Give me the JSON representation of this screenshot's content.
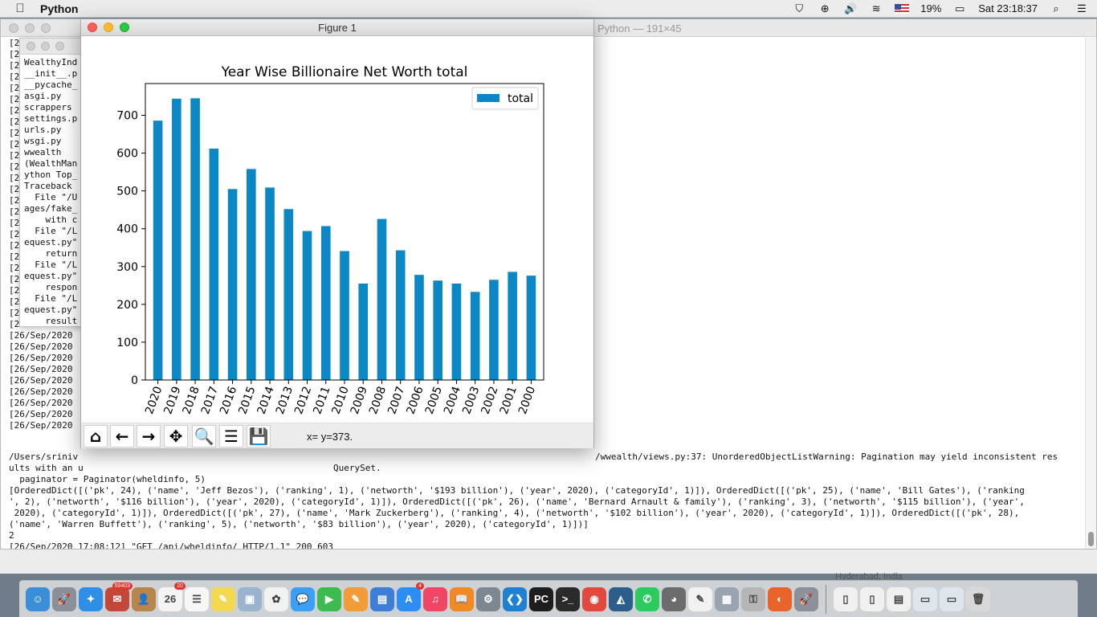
{
  "menubar": {
    "apple_icon": "apple-logo-icon",
    "app_name": "Python",
    "battery": "19%",
    "clock": "Sat 23:18:37",
    "status_icons": [
      "vpn-shield-icon",
      "accessibility-icon",
      "volume-icon",
      "wifi-icon",
      "us-flag-icon",
      "battery-icon",
      "spotlight-search-icon",
      "notification-center-icon"
    ]
  },
  "terminal": {
    "title": "Python — 191×45",
    "left_column": [
      "[20",
      "[20",
      "[20",
      "[20",
      "[20",
      "[20",
      "[20",
      "[20",
      "[20",
      "[20",
      "[20",
      "[20",
      "[20",
      "[20",
      "[20",
      "[20",
      "[20",
      "[20",
      "[20",
      "[20",
      "[20",
      "[20",
      "[20",
      "[20",
      "[20",
      "[20",
      "[26/Sep/2020",
      "[26/Sep/2020",
      "[26/Sep/2020",
      "[26/Sep/2020",
      "[26/Sep/2020",
      "[26/Sep/2020",
      "[26/Sep/2020",
      "[26/Sep/2020",
      "[26/Sep/2020"
    ],
    "right_fragment": "/wwealth/views.py:37: UnorderedObjectListWarning: Pagination may yield inconsistent res",
    "bottom_lines": [
      "/Users/sriniv",
      "ults with an u                                               QuerySet.",
      "  paginator = Paginator(wheldinfo, 5)",
      "[OrderedDict([('pk', 24), ('name', 'Jeff Bezos'), ('ranking', 1), ('networth', '$193 billion'), ('year', 2020), ('categoryId', 1)]), OrderedDict([('pk', 25), ('name', 'Bill Gates'), ('ranking",
      "', 2), ('networth', '$116 billion'), ('year', 2020), ('categoryId', 1)]), OrderedDict([('pk', 26), ('name', 'Bernard Arnault & family'), ('ranking', 3), ('networth', '$115 billion'), ('year',",
      " 2020), ('categoryId', 1)]), OrderedDict([('pk', 27), ('name', 'Mark Zuckerberg'), ('ranking', 4), ('networth', '$102 billion'), ('year', 2020), ('categoryId', 1)]), OrderedDict([('pk', 28),",
      "('name', 'Warren Buffett'), ('ranking', 5), ('networth', '$83 billion'), ('year', 2020), ('categoryId', 1)])]",
      "2",
      "[26/Sep/2020 17:08:12] \"GET /api/wheldinfo/ HTTP/1.1\" 200 603"
    ]
  },
  "inner_terminal": {
    "lines": [
      "WealthyInd",
      "__init__.p",
      "__pycache_",
      "asgi.py",
      "scrappers",
      "settings.p",
      "urls.py",
      "wsgi.py",
      "wwealth",
      "(WealthMan",
      "ython Top_",
      "Traceback ",
      "  File \"/U",
      "ages/fake_",
      "    with c",
      "  File \"/L",
      "equest.py\"",
      "    return",
      "  File \"/L",
      "equest.py\"",
      "    respon",
      "  File \"/L",
      "equest.py\"",
      "    result"
    ]
  },
  "figure": {
    "window_title": "Figure 1",
    "coord_readout": "x= y=373.",
    "toolbar": [
      {
        "name": "home-button",
        "icon": "home-icon",
        "glyph": "⌂"
      },
      {
        "name": "back-button",
        "icon": "arrow-left-icon",
        "glyph": "←"
      },
      {
        "name": "forward-button",
        "icon": "arrow-right-icon",
        "glyph": "→"
      },
      {
        "name": "pan-button",
        "icon": "move-arrows-icon",
        "glyph": "✥"
      },
      {
        "name": "zoom-button",
        "icon": "magnifier-icon",
        "glyph": "🔍"
      },
      {
        "name": "subplots-button",
        "icon": "sliders-icon",
        "glyph": "☰"
      },
      {
        "name": "save-button",
        "icon": "floppy-disk-icon",
        "glyph": "💾"
      }
    ]
  },
  "chart_data": {
    "type": "bar",
    "title": "Year Wise Billionaire Net Worth total",
    "xlabel": "",
    "ylabel": "",
    "categories": [
      "2020",
      "2019",
      "2018",
      "2017",
      "2016",
      "2015",
      "2014",
      "2013",
      "2012",
      "2011",
      "2010",
      "2009",
      "2008",
      "2007",
      "2006",
      "2005",
      "2004",
      "2003",
      "2002",
      "2001",
      "2000"
    ],
    "series": [
      {
        "name": "total",
        "color": "#0a87c4",
        "values": [
          686,
          744,
          745,
          612,
          505,
          558,
          509,
          452,
          394,
          407,
          341,
          255,
          426,
          343,
          278,
          263,
          255,
          233,
          265,
          286,
          276
        ]
      }
    ],
    "ylim": [
      0,
      784
    ],
    "yticks": [
      0,
      100,
      200,
      300,
      400,
      500,
      600,
      700
    ],
    "xtick_rotation": "-70deg",
    "legend": "top-right",
    "grid": false
  },
  "dock": {
    "apps": [
      {
        "name": "finder",
        "icon": "finder-icon",
        "color": "#3b8fd9",
        "glyph": "☺"
      },
      {
        "name": "launchpad",
        "icon": "rocket-icon",
        "color": "#8a8f9a",
        "glyph": "🚀"
      },
      {
        "name": "safari",
        "icon": "compass-icon",
        "color": "#2f8ee5",
        "glyph": "✦"
      },
      {
        "name": "mail",
        "icon": "mail-icon",
        "color": "#c4473a",
        "glyph": "✉",
        "badge": "59403"
      },
      {
        "name": "contacts",
        "icon": "contacts-icon",
        "color": "#b8864a",
        "glyph": "👤"
      },
      {
        "name": "calendar",
        "icon": "calendar-icon",
        "color": "#f4f4f4",
        "glyph": "26",
        "badge": "20"
      },
      {
        "name": "reminders",
        "icon": "list-icon",
        "color": "#f7f7f7",
        "glyph": "☰"
      },
      {
        "name": "notes",
        "icon": "notes-icon",
        "color": "#f3d94f",
        "glyph": "✎"
      },
      {
        "name": "preview",
        "icon": "photos-viewer-icon",
        "color": "#9ab4cf",
        "glyph": "▣"
      },
      {
        "name": "photos",
        "icon": "photos-flower-icon",
        "color": "#f2f2f2",
        "glyph": "✿"
      },
      {
        "name": "messages",
        "icon": "chat-bubble-icon",
        "color": "#3aa0f5",
        "glyph": "💬"
      },
      {
        "name": "facetime",
        "icon": "camera-icon",
        "color": "#3dbb4f",
        "glyph": "▶"
      },
      {
        "name": "pages",
        "icon": "document-pen-icon",
        "color": "#f19b39",
        "glyph": "✎"
      },
      {
        "name": "keynote",
        "icon": "presentation-icon",
        "color": "#3d7fd6",
        "glyph": "▤"
      },
      {
        "name": "app-store",
        "icon": "app-store-icon",
        "color": "#2c8ef3",
        "glyph": "A",
        "badge": "4"
      },
      {
        "name": "music",
        "icon": "music-note-icon",
        "color": "#f04565",
        "glyph": "♫"
      },
      {
        "name": "books",
        "icon": "book-icon",
        "color": "#f08a24",
        "glyph": "📖"
      },
      {
        "name": "system-preferences",
        "icon": "gear-icon",
        "color": "#7d8791",
        "glyph": "⚙"
      },
      {
        "name": "vscode",
        "icon": "code-icon",
        "color": "#1f7fd0",
        "glyph": "❮❯"
      },
      {
        "name": "pycharm",
        "icon": "pycharm-icon",
        "color": "#1d1d1d",
        "glyph": "PC"
      },
      {
        "name": "terminal",
        "icon": "terminal-icon",
        "color": "#2a2a2a",
        "glyph": ">_"
      },
      {
        "name": "chrome",
        "icon": "chrome-icon",
        "color": "#e2483b",
        "glyph": "◉"
      },
      {
        "name": "mysql-workbench",
        "icon": "dolphin-icon",
        "color": "#2d5d8a",
        "glyph": "◭"
      },
      {
        "name": "whatsapp",
        "icon": "whatsapp-icon",
        "color": "#2bcc5d",
        "glyph": "✆"
      },
      {
        "name": "sequel-pro",
        "icon": "elephant-icon",
        "color": "#6c6c6c",
        "glyph": "◕"
      },
      {
        "name": "textedit",
        "icon": "pencil-paper-icon",
        "color": "#f2f2f2",
        "glyph": "✎"
      },
      {
        "name": "screenshot",
        "icon": "screenshot-icon",
        "color": "#9aa4b0",
        "glyph": "▦"
      },
      {
        "name": "keychain",
        "icon": "keys-icon",
        "color": "#b6b6b6",
        "glyph": "⚿"
      },
      {
        "name": "firefox",
        "icon": "firefox-icon",
        "color": "#e8642a",
        "glyph": "◐"
      },
      {
        "name": "python-launcher",
        "icon": "rocket-python-icon",
        "color": "#8c9098",
        "glyph": "🚀"
      }
    ],
    "stack_items": [
      {
        "name": "downloads-stack",
        "icon": "zip-file-icon",
        "color": "#f0f0f0",
        "glyph": "▯"
      },
      {
        "name": "pdf-stack",
        "icon": "pdf-file-icon",
        "color": "#f0f0f0",
        "glyph": "▯"
      },
      {
        "name": "documents-stack",
        "icon": "documents-icon",
        "color": "#f0f0f0",
        "glyph": "▤"
      },
      {
        "name": "desktop-stack",
        "icon": "desktop-screenshots-icon",
        "color": "#dfe5ec",
        "glyph": "▭"
      },
      {
        "name": "screens-stack",
        "icon": "screens-icon",
        "color": "#dfe5ec",
        "glyph": "▭"
      },
      {
        "name": "trash",
        "icon": "trash-icon",
        "color": "#d8d8d8",
        "glyph": "🗑"
      }
    ]
  },
  "desktop": {
    "location_label": "Hyderabad, India"
  }
}
